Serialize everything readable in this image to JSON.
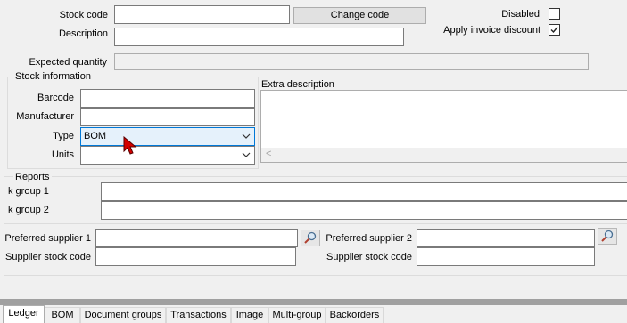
{
  "form": {
    "stock_code_label": "Stock code",
    "stock_code_value": "",
    "change_code_button": "Change code",
    "description_label": "Description",
    "description_value": "",
    "disabled_label": "Disabled",
    "disabled_checked": false,
    "apply_invoice_discount_label": "Apply invoice discount",
    "apply_invoice_discount_checked": true,
    "expected_quantity_label": "Expected quantity",
    "expected_quantity_value": ""
  },
  "stock_information": {
    "title": "Stock information",
    "barcode_label": "Barcode",
    "barcode_value": "",
    "manufacturer_label": "Manufacturer",
    "manufacturer_value": "",
    "type_label": "Type",
    "type_value": "BOM",
    "units_label": "Units",
    "units_value": ""
  },
  "extra_description": {
    "title": "Extra description",
    "value": "",
    "scroll_left_glyph": "<"
  },
  "reports": {
    "title": "Reports",
    "group1_label": "k group 1",
    "group1_value": "",
    "group2_label": "k group 2",
    "group2_value": ""
  },
  "suppliers": {
    "preferred_supplier_1_label": "Preferred supplier 1",
    "preferred_supplier_1_value": "",
    "supplier_stock_code_1_label": "Supplier stock code",
    "supplier_stock_code_1_value": "",
    "preferred_supplier_2_label": "Preferred supplier 2",
    "preferred_supplier_2_value": "",
    "supplier_stock_code_2_label": "Supplier stock code",
    "supplier_stock_code_2_value": ""
  },
  "tabs": [
    {
      "label": "Ledger",
      "active": true
    },
    {
      "label": "BOM"
    },
    {
      "label": "Document groups"
    },
    {
      "label": "Transactions"
    },
    {
      "label": "Image"
    },
    {
      "label": "Multi-group"
    },
    {
      "label": "Backorders"
    }
  ],
  "colors": {
    "window_bg": "#f0f0f0",
    "focus_border": "#0078d7",
    "selected_combo_bg": "#e5f1fb",
    "cursor_red": "#d40000"
  },
  "icons": {
    "search": "magnifier-icon",
    "dropdown": "chevron-down-icon",
    "checkbox_check": "check-icon",
    "cursor": "mouse-pointer-icon"
  }
}
